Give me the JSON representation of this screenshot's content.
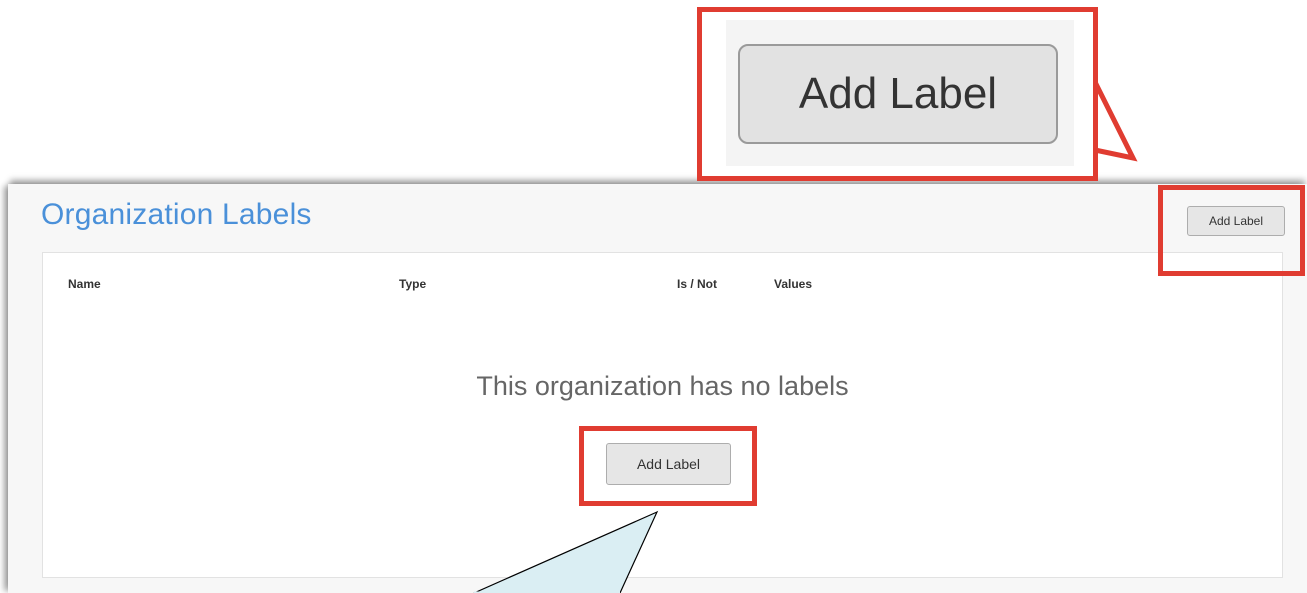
{
  "header": {
    "title": "Organization Labels",
    "add_label": "Add Label"
  },
  "table": {
    "columns": [
      "Name",
      "Type",
      "Is / Not",
      "Values"
    ]
  },
  "empty_state": {
    "message": "This organization has no labels",
    "add_label": "Add Label"
  },
  "zoom_callout": {
    "button_label": "Add Label"
  },
  "colors": {
    "title_blue": "#4a90d9",
    "highlight_red": "#e03c31",
    "callout_fill": "#daeef3"
  }
}
